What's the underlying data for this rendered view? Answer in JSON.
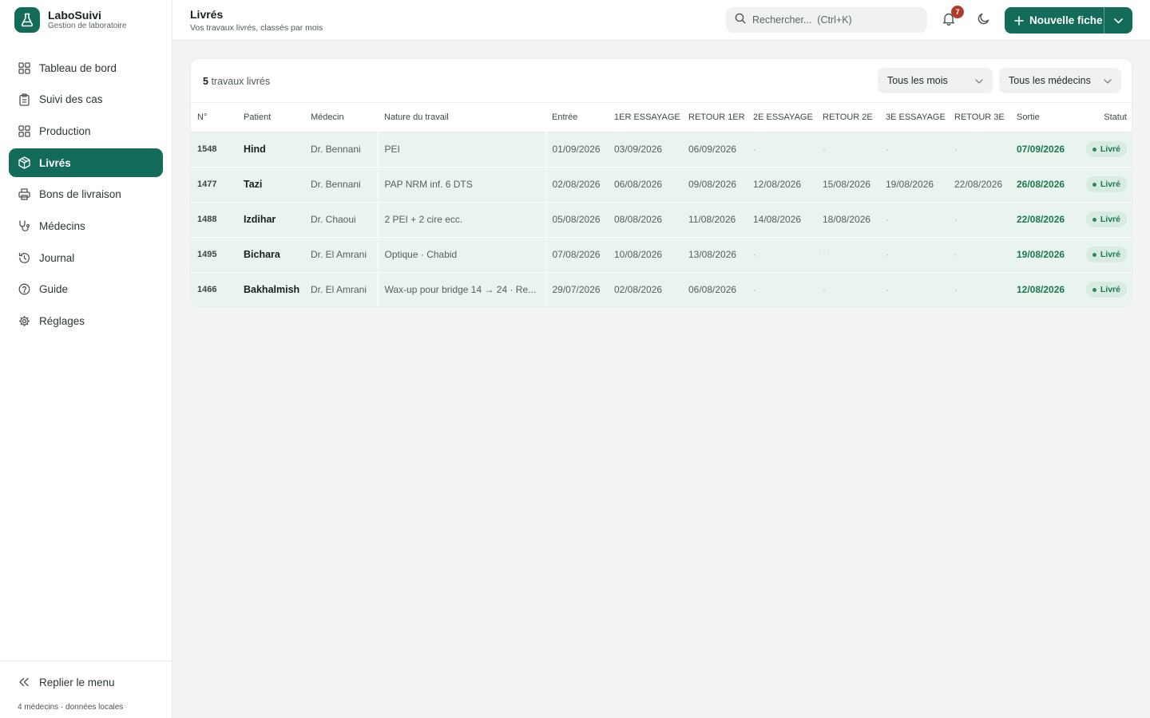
{
  "app": {
    "name": "LaboSuivi",
    "subtitle": "Gestion de laboratoire"
  },
  "sidebar": {
    "items": [
      {
        "label": "Tableau de bord",
        "icon": "grid-icon"
      },
      {
        "label": "Suivi des cas",
        "icon": "clipboard-icon"
      },
      {
        "label": "Production",
        "icon": "grid-icon"
      },
      {
        "label": "Livrés",
        "icon": "package-icon",
        "active": true
      },
      {
        "label": "Bons de livraison",
        "icon": "printer-icon"
      },
      {
        "label": "Médecins",
        "icon": "stethoscope-icon"
      },
      {
        "label": "Journal",
        "icon": "history-icon"
      },
      {
        "label": "Guide",
        "icon": "help-circle-icon"
      },
      {
        "label": "Réglages",
        "icon": "gear-icon"
      }
    ],
    "collapse_label": "Replier le menu",
    "footer_note": "4 médecins · données locales"
  },
  "header": {
    "title": "Livrés",
    "subtitle": "Vos travaux livrés, classés par mois",
    "search_placeholder": "Rechercher...  (Ctrl+K)",
    "notification_count": "7",
    "new_button_label": "Nouvelle fiche"
  },
  "filters": {
    "count_number": "5",
    "count_label": "travaux livrés",
    "month_select": "Tous les mois",
    "doctor_select": "Tous les médecins"
  },
  "table": {
    "columns": [
      "N°",
      "Patient",
      "Médecin",
      "Nature du travail",
      "Entrée",
      "1ER ESSAYAGE",
      "RETOUR 1ER",
      "2E ESSAYAGE",
      "RETOUR 2E",
      "3E ESSAYAGE",
      "RETOUR 3E",
      "Sortie",
      "Statut"
    ],
    "rows": [
      {
        "num": "1548",
        "patient": "Hind",
        "doctor": "Dr. Bennani",
        "nature": "PEI",
        "entree": "01/09/2026",
        "ess1": "03/09/2026",
        "ret1": "06/09/2026",
        "ess2": "·",
        "ret2": "·",
        "ess3": "·",
        "ret3": "·",
        "sortie": "07/09/2026",
        "statut": "Livré"
      },
      {
        "num": "1477",
        "patient": "Tazi",
        "doctor": "Dr. Bennani",
        "nature": "PAP NRM inf. 6 DTS",
        "entree": "02/08/2026",
        "ess1": "06/08/2026",
        "ret1": "09/08/2026",
        "ess2": "12/08/2026",
        "ret2": "15/08/2026",
        "ess3": "19/08/2026",
        "ret3": "22/08/2026",
        "sortie": "26/08/2026",
        "statut": "Livré"
      },
      {
        "num": "1488",
        "patient": "Izdihar",
        "doctor": "Dr. Chaoui",
        "nature": "2 PEI + 2 cire ecc.",
        "entree": "05/08/2026",
        "ess1": "08/08/2026",
        "ret1": "11/08/2026",
        "ess2": "14/08/2026",
        "ret2": "18/08/2026",
        "ess3": "·",
        "ret3": "·",
        "sortie": "22/08/2026",
        "statut": "Livré"
      },
      {
        "num": "1495",
        "patient": "Bichara",
        "doctor": "Dr. El Amrani",
        "nature": "Optique · Chabid",
        "entree": "07/08/2026",
        "ess1": "10/08/2026",
        "ret1": "13/08/2026",
        "ess2": "·",
        "ret2": "·",
        "ess3": "·",
        "ret3": "·",
        "sortie": "19/08/2026",
        "statut": "Livré"
      },
      {
        "num": "1466",
        "patient": "Bakhalmish",
        "doctor": "Dr. El Amrani",
        "nature": "Wax-up pour bridge 14 → 24 · Re...",
        "entree": "29/07/2026",
        "ess1": "02/08/2026",
        "ret1": "06/08/2026",
        "ess2": "·",
        "ret2": "·",
        "ess3": "·",
        "ret3": "·",
        "sortie": "12/08/2026",
        "statut": "Livré"
      }
    ]
  },
  "colors": {
    "brand": "#136b59",
    "row_bg": "#eaf4ee",
    "status_green": "#1a7a4e",
    "badge_red": "#b03a2e"
  }
}
